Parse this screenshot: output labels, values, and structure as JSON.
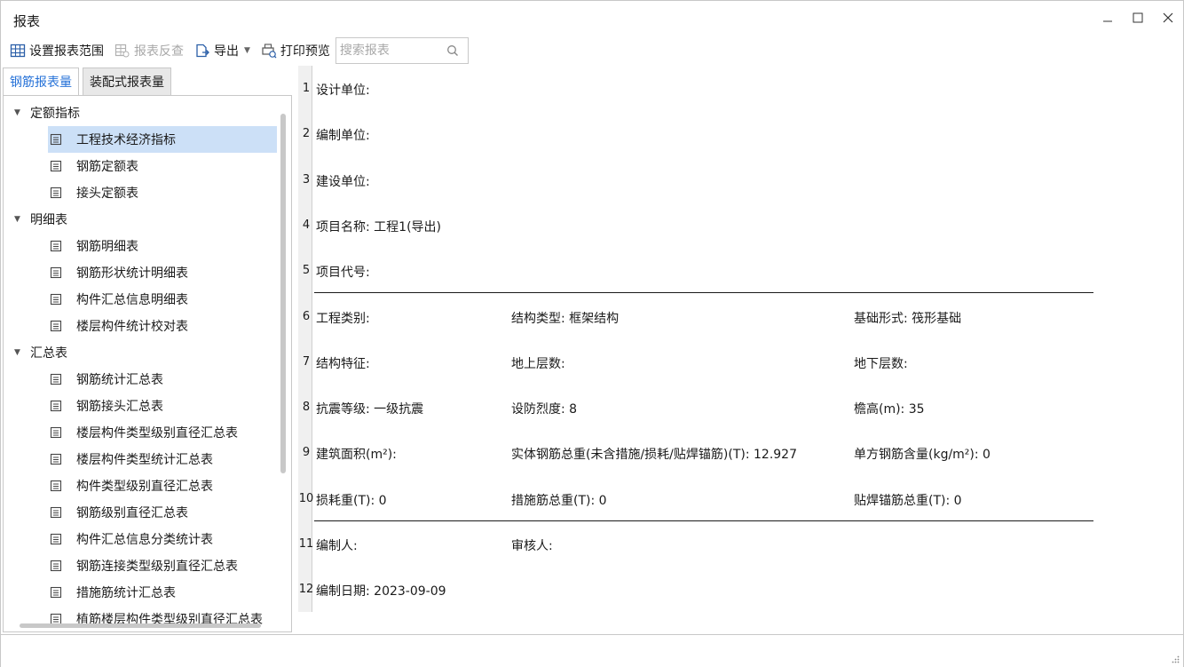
{
  "window": {
    "title": "报表"
  },
  "toolbar": {
    "set_range": "设置报表范围",
    "reverse_check": "报表反查",
    "export": "导出",
    "print_preview": "打印预览",
    "search_placeholder": "搜索报表"
  },
  "tabs": [
    {
      "label": "钢筋报表量",
      "active": true
    },
    {
      "label": "装配式报表量",
      "active": false
    }
  ],
  "tree": {
    "groups": [
      {
        "label": "定额指标",
        "items": [
          "工程技术经济指标",
          "钢筋定额表",
          "接头定额表"
        ]
      },
      {
        "label": "明细表",
        "items": [
          "钢筋明细表",
          "钢筋形状统计明细表",
          "构件汇总信息明细表",
          "楼层构件统计校对表"
        ]
      },
      {
        "label": "汇总表",
        "items": [
          "钢筋统计汇总表",
          "钢筋接头汇总表",
          "楼层构件类型级别直径汇总表",
          "楼层构件类型统计汇总表",
          "构件类型级别直径汇总表",
          "钢筋级别直径汇总表",
          "构件汇总信息分类统计表",
          "钢筋连接类型级别直径汇总表",
          "措施筋统计汇总表",
          "植筋楼层构件类型级别直径汇总表"
        ]
      }
    ],
    "selected": "工程技术经济指标"
  },
  "report": {
    "rows": [
      {
        "num": "1",
        "cells": [
          "设计单位:"
        ]
      },
      {
        "num": "2",
        "cells": [
          "编制单位:"
        ]
      },
      {
        "num": "3",
        "cells": [
          "建设单位:"
        ]
      },
      {
        "num": "4",
        "cells": [
          "项目名称: 工程1(导出)"
        ]
      },
      {
        "num": "5",
        "cells": [
          "项目代号:"
        ]
      },
      {
        "num": "6",
        "cells": [
          "工程类别:",
          "结构类型: 框架结构",
          "基础形式: 筏形基础"
        ]
      },
      {
        "num": "7",
        "cells": [
          "结构特征:",
          "地上层数:",
          "地下层数:"
        ]
      },
      {
        "num": "8",
        "cells": [
          "抗震等级: 一级抗震",
          "设防烈度: 8",
          "檐高(m): 35"
        ]
      },
      {
        "num": "9",
        "cells": [
          "建筑面积(m²):",
          "实体钢筋总重(未含措施/损耗/贴焊锚筋)(T): 12.927",
          "单方钢筋含量(kg/m²): 0"
        ]
      },
      {
        "num": "10",
        "cells": [
          "损耗重(T): 0",
          "措施筋总重(T): 0",
          "贴焊锚筋总重(T): 0"
        ]
      },
      {
        "num": "11",
        "cells": [
          "编制人:",
          "审核人:"
        ]
      },
      {
        "num": "12",
        "cells": [
          "编制日期: 2023-09-09"
        ]
      }
    ]
  },
  "colors": {
    "accent": "#2672d8",
    "selected_bg": "#cce0f7",
    "border": "#c8c8c8"
  },
  "icons": {
    "set_range": "grid-icon",
    "reverse_check": "reverse-lookup-icon",
    "export": "export-icon",
    "print_preview": "print-preview-icon",
    "search": "search-icon",
    "tree_leaf": "document-icon"
  }
}
